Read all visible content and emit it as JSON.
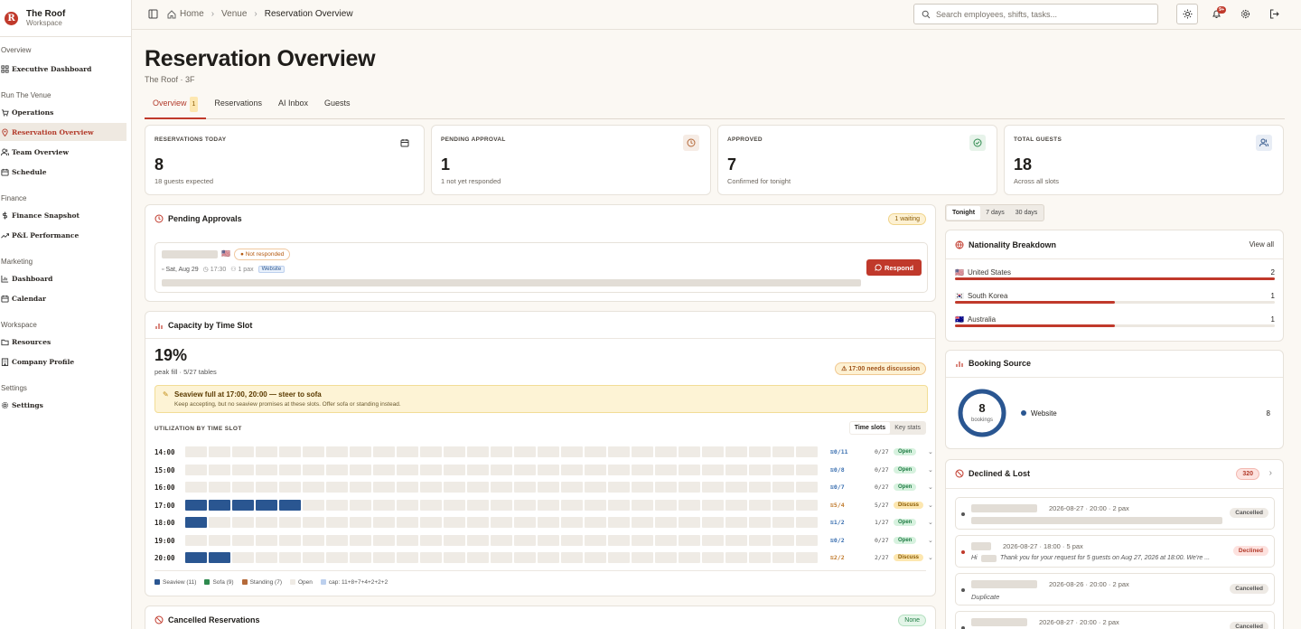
{
  "brand": {
    "name": "The Roof",
    "sub": "Workspace",
    "logo": "R"
  },
  "sidebar": {
    "sections": [
      {
        "title": "Overview",
        "items": [
          {
            "label": "Executive Dashboard",
            "icon": "dashboard-icon"
          }
        ]
      },
      {
        "title": "Run The Venue",
        "items": [
          {
            "label": "Operations",
            "icon": "cart-icon"
          },
          {
            "label": "Reservation Overview",
            "icon": "pin-icon",
            "active": true
          },
          {
            "label": "Team Overview",
            "icon": "users-icon"
          },
          {
            "label": "Schedule",
            "icon": "calendar-icon"
          }
        ]
      },
      {
        "title": "Finance",
        "items": [
          {
            "label": "Finance Snapshot",
            "icon": "dollar-icon"
          },
          {
            "label": "P&L Performance",
            "icon": "trend-icon"
          }
        ]
      },
      {
        "title": "Marketing",
        "items": [
          {
            "label": "Dashboard",
            "icon": "chart-icon"
          },
          {
            "label": "Calendar",
            "icon": "calendar-icon"
          }
        ]
      },
      {
        "title": "Workspace",
        "items": [
          {
            "label": "Resources",
            "icon": "folder-icon"
          },
          {
            "label": "Company Profile",
            "icon": "building-icon"
          }
        ]
      },
      {
        "title": "Settings",
        "items": [
          {
            "label": "Settings",
            "icon": "gear-icon"
          }
        ]
      }
    ]
  },
  "breadcrumb": {
    "home": "Home",
    "venue": "Venue",
    "current": "Reservation Overview"
  },
  "search": {
    "placeholder": "Search employees, shifts, tasks..."
  },
  "notif_badge": "9+",
  "page": {
    "title": "Reservation Overview",
    "subtitle": "The Roof · 3F"
  },
  "tabs": [
    {
      "label": "Overview",
      "count": "1"
    },
    {
      "label": "Reservations"
    },
    {
      "label": "AI Inbox"
    },
    {
      "label": "Guests"
    }
  ],
  "stats": [
    {
      "label": "RESERVATIONS TODAY",
      "value": "8",
      "sub": "18 guests expected",
      "icon": "calendar-icon"
    },
    {
      "label": "PENDING APPROVAL",
      "value": "1",
      "sub": "1 not yet responded",
      "icon": "clock-icon"
    },
    {
      "label": "APPROVED",
      "value": "7",
      "sub": "Confirmed for tonight",
      "icon": "check-circle-icon"
    },
    {
      "label": "TOTAL GUESTS",
      "value": "18",
      "sub": "Across all slots",
      "icon": "users-icon"
    }
  ],
  "pending": {
    "title": "Pending Approvals",
    "badge": "1 waiting",
    "status": "Not responded",
    "date": "Sat, Aug 29",
    "time": "17:30",
    "pax": "1 pax",
    "source": "Website",
    "respond": "Respond"
  },
  "capacity": {
    "title": "Capacity by Time Slot",
    "peak": "19%",
    "peak_sub": "peak fill · 5/27 tables",
    "needs": "17:00 needs discussion",
    "alert_title": "Seaview full at 17:00, 20:00 — steer to sofa",
    "alert_sub": "Keep accepting, but no seaview promises at these slots. Offer sofa or standing instead.",
    "util_label": "UTILIZATION BY TIME SLOT",
    "toggle": [
      "Time slots",
      "Key stats"
    ],
    "slots": [
      {
        "time": "14:00",
        "filled": 0,
        "cap": "0/11",
        "count": "0/27",
        "status": "Open"
      },
      {
        "time": "15:00",
        "filled": 0,
        "cap": "0/8",
        "count": "0/27",
        "status": "Open"
      },
      {
        "time": "16:00",
        "filled": 0,
        "cap": "0/7",
        "count": "0/27",
        "status": "Open"
      },
      {
        "time": "17:00",
        "filled": 5,
        "cap": "5/4",
        "count": "5/27",
        "status": "Discuss"
      },
      {
        "time": "18:00",
        "filled": 1,
        "cap": "1/2",
        "count": "1/27",
        "status": "Open"
      },
      {
        "time": "19:00",
        "filled": 0,
        "cap": "0/2",
        "count": "0/27",
        "status": "Open"
      },
      {
        "time": "20:00",
        "filled": 2,
        "cap": "2/2",
        "count": "2/27",
        "status": "Discuss"
      }
    ],
    "legend": [
      "Seaview (11)",
      "Sofa (9)",
      "Standing (7)",
      "Open",
      "cap: 11+8+7+4+2+2+2"
    ]
  },
  "cancelled": {
    "title": "Cancelled Reservations",
    "badge": "None"
  },
  "range": [
    "Tonight",
    "7 days",
    "30 days"
  ],
  "nationality": {
    "title": "Nationality Breakdown",
    "view_all": "View all",
    "rows": [
      {
        "country": "United States",
        "flag": "🇺🇸",
        "count": "2",
        "fraction": 1.0
      },
      {
        "country": "South Korea",
        "flag": "🇰🇷",
        "count": "1",
        "fraction": 0.5
      },
      {
        "country": "Australia",
        "flag": "🇦🇺",
        "count": "1",
        "fraction": 0.5
      }
    ]
  },
  "source": {
    "title": "Booking Source",
    "total": "8",
    "unit": "bookings",
    "items": [
      {
        "label": "Website",
        "count": "8",
        "color": "#2a5691"
      }
    ]
  },
  "declined": {
    "title": "Declined & Lost",
    "count": "320",
    "rows": [
      {
        "meta": "2026-08-27 · 20:00 · 2 pax",
        "status": "Cancelled",
        "note": ""
      },
      {
        "meta": "2026-08-27 · 18:00 · 5 pax",
        "status": "Declined",
        "note": "Thank you for your request for 5 guests on Aug 27, 2026 at 18:00. We're ..."
      },
      {
        "meta": "2026-08-26 · 20:00 · 2 pax",
        "status": "Cancelled",
        "note": "Duplicate"
      },
      {
        "meta": "2026-08-27 · 20:00 · 2 pax",
        "status": "Cancelled",
        "note": ""
      }
    ]
  }
}
